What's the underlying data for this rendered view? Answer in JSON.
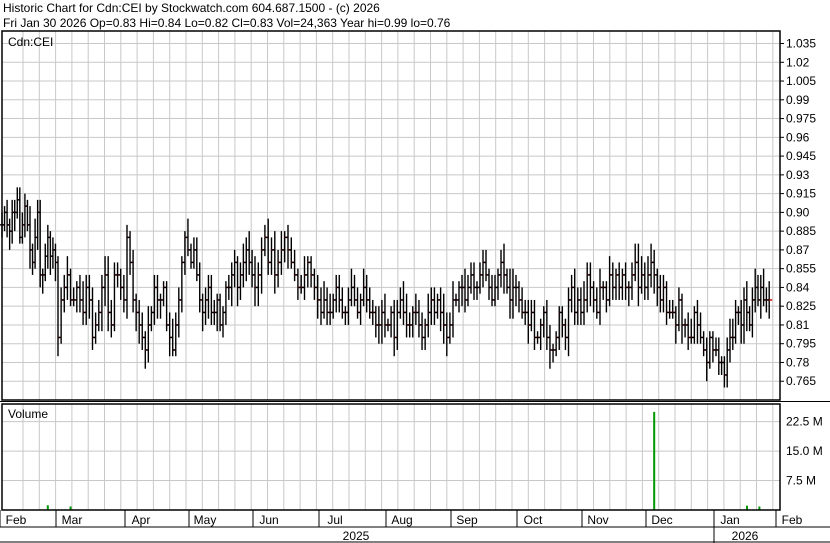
{
  "header": {
    "title": "Historic Chart for Cdn:CEI by Stockwatch.com 604.687.1500 - (c) 2026",
    "summary": "Fri Jan 30 2026  Op=0.83  Hi=0.84  Lo=0.82  Cl=0.83  Vol=24,363  Year hi=0.99  lo=0.76"
  },
  "colors": {
    "bar": "#000000",
    "close_tick": "#cc0000",
    "volume": "#009900",
    "grid": "#c8c8c8",
    "border": "#000000"
  },
  "chart_data": {
    "type": "ohlc",
    "symbol_label": "Cdn:CEI",
    "volume_label": "Volume",
    "price_axis": {
      "ticks": [
        0.765,
        0.78,
        0.795,
        0.81,
        0.825,
        0.84,
        0.855,
        0.87,
        0.885,
        0.9,
        0.915,
        0.93,
        0.945,
        0.96,
        0.975,
        0.99,
        1.005,
        1.02,
        1.035
      ],
      "tick_labels": [
        "0.765",
        "0.78",
        "0.795",
        "0.81",
        "0.825",
        "0.84",
        "0.855",
        "0.87",
        "0.885",
        "0.90",
        "0.915",
        "0.93",
        "0.945",
        "0.96",
        "0.975",
        "0.99",
        "1.005",
        "1.02",
        "1.035"
      ],
      "ylim": [
        0.75,
        1.045
      ]
    },
    "volume_axis": {
      "ticks": [
        7500000,
        15000000,
        22500000
      ],
      "tick_labels": [
        "7.5 M",
        "15.0 M",
        "22.5 M"
      ],
      "ylim": [
        0,
        27000000
      ]
    },
    "month_labels": [
      "Feb",
      "Mar",
      "Apr",
      "May",
      "Jun",
      "Jul",
      "Aug",
      "Sep",
      "Oct",
      "Nov",
      "Dec",
      "Jan",
      "Feb"
    ],
    "year_labels": [
      "2025",
      "2026"
    ],
    "bars_per_month": [
      22,
      22,
      21,
      22,
      20,
      22,
      21,
      22,
      21,
      20,
      22,
      20
    ],
    "closes": [
      0.89,
      0.9,
      0.89,
      0.885,
      0.9,
      0.9,
      0.91,
      0.88,
      0.89,
      0.905,
      0.89,
      0.87,
      0.86,
      0.88,
      0.9,
      0.85,
      0.85,
      0.865,
      0.88,
      0.865,
      0.87,
      0.86,
      0.8,
      0.83,
      0.84,
      0.85,
      0.83,
      0.83,
      0.84,
      0.83,
      0.82,
      0.84,
      0.83,
      0.8,
      0.81,
      0.82,
      0.84,
      0.85,
      0.82,
      0.81,
      0.85,
      0.85,
      0.84,
      0.83,
      0.88,
      0.86,
      0.83,
      0.82,
      0.81,
      0.8,
      0.79,
      0.81,
      0.82,
      0.84,
      0.83,
      0.83,
      0.84,
      0.81,
      0.8,
      0.79,
      0.81,
      0.83,
      0.86,
      0.88,
      0.87,
      0.86,
      0.87,
      0.85,
      0.83,
      0.82,
      0.83,
      0.84,
      0.82,
      0.82,
      0.83,
      0.81,
      0.82,
      0.84,
      0.84,
      0.85,
      0.86,
      0.84,
      0.85,
      0.86,
      0.87,
      0.86,
      0.85,
      0.84,
      0.85,
      0.87,
      0.88,
      0.86,
      0.87,
      0.85,
      0.86,
      0.87,
      0.88,
      0.87,
      0.86,
      0.85,
      0.84,
      0.84,
      0.85,
      0.86,
      0.85,
      0.84,
      0.83,
      0.82,
      0.83,
      0.82,
      0.82,
      0.83,
      0.84,
      0.83,
      0.82,
      0.82,
      0.83,
      0.84,
      0.83,
      0.82,
      0.83,
      0.84,
      0.83,
      0.82,
      0.82,
      0.81,
      0.81,
      0.82,
      0.81,
      0.81,
      0.82,
      0.8,
      0.82,
      0.83,
      0.82,
      0.81,
      0.81,
      0.82,
      0.82,
      0.81,
      0.8,
      0.81,
      0.82,
      0.83,
      0.82,
      0.83,
      0.82,
      0.81,
      0.8,
      0.81,
      0.83,
      0.83,
      0.84,
      0.84,
      0.83,
      0.84,
      0.85,
      0.84,
      0.84,
      0.85,
      0.86,
      0.85,
      0.84,
      0.83,
      0.84,
      0.85,
      0.86,
      0.85,
      0.84,
      0.83,
      0.84,
      0.84,
      0.83,
      0.82,
      0.82,
      0.81,
      0.82,
      0.8,
      0.8,
      0.81,
      0.82,
      0.8,
      0.79,
      0.79,
      0.8,
      0.82,
      0.81,
      0.8,
      0.83,
      0.84,
      0.82,
      0.83,
      0.82,
      0.83,
      0.85,
      0.84,
      0.83,
      0.82,
      0.84,
      0.84,
      0.83,
      0.85,
      0.84,
      0.85,
      0.84,
      0.85,
      0.84,
      0.84,
      0.85,
      0.86,
      0.84,
      0.85,
      0.84,
      0.85,
      0.86,
      0.85,
      0.84,
      0.83,
      0.84,
      0.82,
      0.82,
      0.82,
      0.81,
      0.83,
      0.81,
      0.81,
      0.8,
      0.8,
      0.82,
      0.81,
      0.8,
      0.79,
      0.78,
      0.8,
      0.79,
      0.79,
      0.78,
      0.78,
      0.77,
      0.79,
      0.8,
      0.8,
      0.82,
      0.82,
      0.81,
      0.83,
      0.82,
      0.81,
      0.83,
      0.84,
      0.83,
      0.84,
      0.83,
      0.83,
      0.83
    ],
    "volume_spikes": [
      {
        "month": "Dec",
        "bar": 2,
        "value": 25000000
      },
      {
        "month": "Feb",
        "bar": 18,
        "value": 1200000
      },
      {
        "month": "Mar",
        "bar": 4,
        "value": 900000
      },
      {
        "month": "Jan",
        "bar": 10,
        "value": 1100000
      },
      {
        "month": "Jan",
        "bar": 14,
        "value": 900000
      }
    ],
    "typical_volume": 150000
  }
}
